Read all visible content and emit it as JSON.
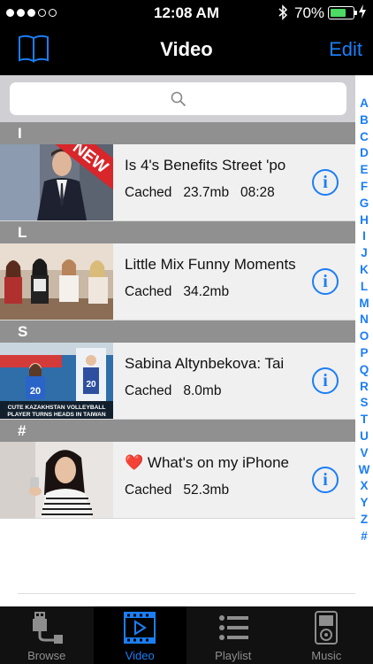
{
  "status_bar": {
    "time": "12:08 AM",
    "battery_percent": "70%",
    "battery_level": 0.7,
    "signal_icon": "signal-dots-icon",
    "bluetooth_icon": "bluetooth-icon",
    "charging_icon": "bolt-icon"
  },
  "nav": {
    "title": "Video",
    "edit_label": "Edit",
    "left_icon": "book-icon"
  },
  "search": {
    "placeholder": "",
    "icon": "search-icon"
  },
  "index_letters": [
    "A",
    "B",
    "C",
    "D",
    "E",
    "F",
    "G",
    "H",
    "I",
    "J",
    "K",
    "L",
    "M",
    "N",
    "O",
    "P",
    "Q",
    "R",
    "S",
    "T",
    "U",
    "V",
    "W",
    "X",
    "Y",
    "Z",
    "#"
  ],
  "sections": [
    {
      "header": "I",
      "items": [
        {
          "title": "Is 4's Benefits Street 'po",
          "status": "Cached",
          "size": "23.7mb",
          "duration": "08:28",
          "badge": "NEW"
        }
      ]
    },
    {
      "header": "L",
      "items": [
        {
          "title": "Little Mix Funny Moments",
          "status": "Cached",
          "size": "34.2mb",
          "duration": ""
        }
      ]
    },
    {
      "header": "S",
      "items": [
        {
          "title": "Sabina Altynbekova: Tai",
          "status": "Cached",
          "size": "8.0mb",
          "duration": "",
          "thumb_caption_1": "CUTE KAZAKHSTAN VOLLEYBALL",
          "thumb_caption_2": "PLAYER TURNS HEADS IN TAIWAN",
          "thumb_jersey": "20"
        }
      ]
    },
    {
      "header": "#",
      "items": [
        {
          "title": "What's on my iPhone",
          "status": "Cached",
          "size": "52.3mb",
          "duration": "",
          "heart": "❤️"
        }
      ]
    }
  ],
  "tabs": [
    {
      "label": "Browse",
      "icon": "usb-cable-icon",
      "active": false
    },
    {
      "label": "Video",
      "icon": "video-icon",
      "active": true
    },
    {
      "label": "Playlist",
      "icon": "list-icon",
      "active": false
    },
    {
      "label": "Music",
      "icon": "ipod-icon",
      "active": false
    }
  ],
  "colors": {
    "accent": "#1b7ef6",
    "section_header": "#909090",
    "row_bg": "#f0f0f0",
    "heart": "#d21e1e",
    "new_ribbon": "#d8262b"
  }
}
